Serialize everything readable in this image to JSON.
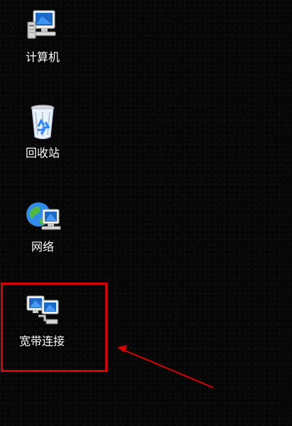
{
  "desktop": {
    "icons": [
      {
        "label": "计算机",
        "icon": "computer-icon"
      },
      {
        "label": "回收站",
        "icon": "recycle-bin-icon"
      },
      {
        "label": "网络",
        "icon": "network-icon"
      },
      {
        "label": "宽带连接",
        "icon": "broadband-connection-icon"
      }
    ]
  },
  "annotation": {
    "highlight_color": "#d80000",
    "arrow_color": "#d80000",
    "target": "宽带连接"
  }
}
